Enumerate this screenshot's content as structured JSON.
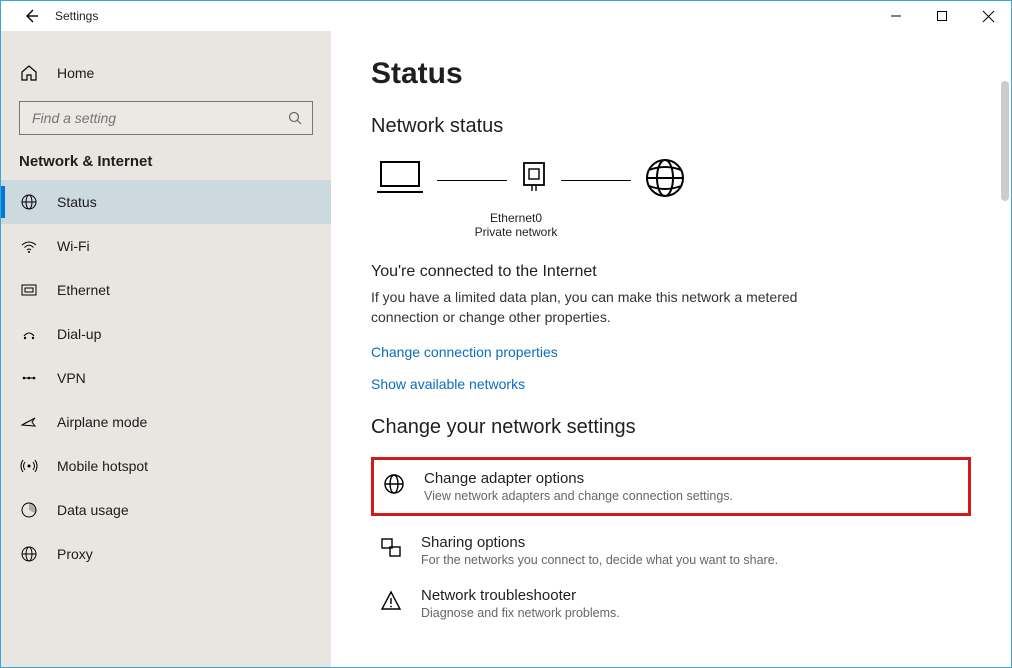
{
  "window": {
    "title": "Settings"
  },
  "sidebar": {
    "home_label": "Home",
    "search_placeholder": "Find a setting",
    "section_title": "Network & Internet",
    "items": [
      {
        "label": "Status"
      },
      {
        "label": "Wi-Fi"
      },
      {
        "label": "Ethernet"
      },
      {
        "label": "Dial-up"
      },
      {
        "label": "VPN"
      },
      {
        "label": "Airplane mode"
      },
      {
        "label": "Mobile hotspot"
      },
      {
        "label": "Data usage"
      },
      {
        "label": "Proxy"
      }
    ]
  },
  "main": {
    "title": "Status",
    "status_header": "Network status",
    "diagram": {
      "adapter_name": "Ethernet0",
      "network_type": "Private network"
    },
    "conn_title": "You're connected to the Internet",
    "conn_desc": "If you have a limited data plan, you can make this network a metered connection or change other properties.",
    "link_change_props": "Change connection properties",
    "link_show_nets": "Show available networks",
    "settings_header": "Change your network settings",
    "rows": [
      {
        "title": "Change adapter options",
        "desc": "View network adapters and change connection settings."
      },
      {
        "title": "Sharing options",
        "desc": "For the networks you connect to, decide what you want to share."
      },
      {
        "title": "Network troubleshooter",
        "desc": "Diagnose and fix network problems."
      }
    ]
  }
}
